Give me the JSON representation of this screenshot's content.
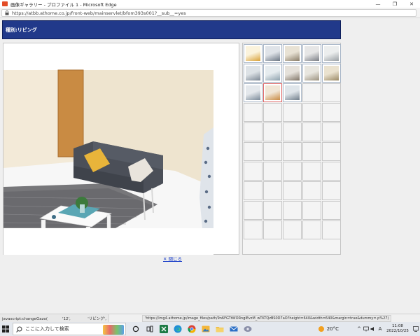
{
  "window": {
    "title": "画像ギャラリー - プロファイル 1 - Microsoft Edge",
    "buttons": {
      "minimize": "—",
      "restore": "❐",
      "close": "✕"
    }
  },
  "address_bar": {
    "url": "https://atbb.athome.co.jp/front-web/mainservlet/bfom393s001?__sub__=yes"
  },
  "page": {
    "header_label": "種別:リビング",
    "close_link": "✕ 閉じる",
    "thumbnails": {
      "columns": 5,
      "rows": 10,
      "filled": [
        {
          "kind": "gold-panel"
        },
        {
          "kind": "room-door"
        },
        {
          "kind": "room-window"
        },
        {
          "kind": "kitchen"
        },
        {
          "kind": "kitchen-light"
        },
        {
          "kind": "hallway"
        },
        {
          "kind": "bathroom"
        },
        {
          "kind": "entrance"
        },
        {
          "kind": "closet"
        },
        {
          "kind": "corridor"
        },
        {
          "kind": "bedroom"
        },
        {
          "kind": "living-sofa",
          "selected": true
        },
        {
          "kind": "wardrobe"
        }
      ]
    }
  },
  "status_bar": {
    "left": "javascript:changeGazo(            '12',              'リビング',",
    "tip": "'https://img4.athome.jp/image_files/path/9n6FGTtWORngiEvzM_wTKTQzBS0D7aO?height=640&width=640&margin=true&dummy=.p%27)"
  },
  "taskbar": {
    "search_placeholder": "ここに入力して検索",
    "weather": "20°C",
    "time": "11:08",
    "date": "2022/10/25",
    "ime": "A"
  },
  "colors": {
    "header_band": "#21398a",
    "link": "#1a3ec8",
    "selected_border": "#e06a6a"
  }
}
